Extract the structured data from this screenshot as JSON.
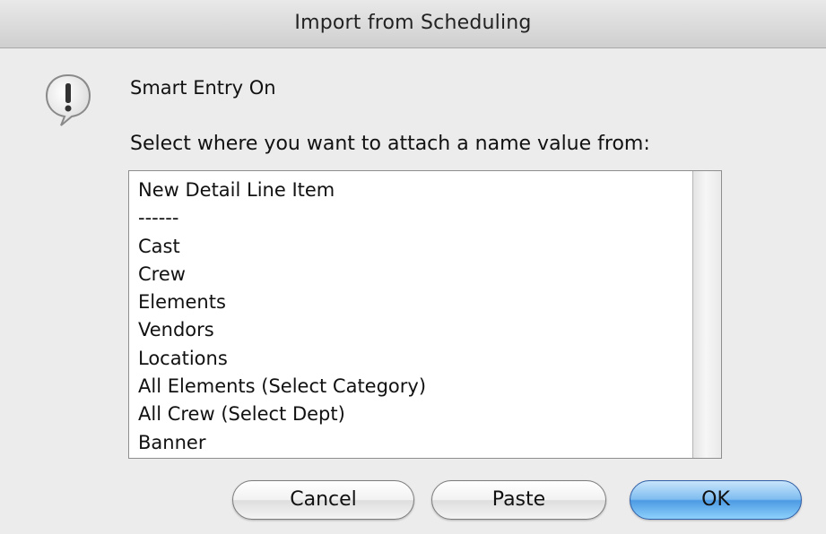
{
  "window": {
    "title": "Import from Scheduling"
  },
  "dialog": {
    "icon": "alert-icon",
    "heading": "Smart Entry On",
    "prompt": "Select where you want to attach a name value from:",
    "list_items": [
      "New Detail Line Item",
      "------",
      "Cast",
      "Crew",
      "Elements",
      "Vendors",
      "Locations",
      "All Elements (Select Category)",
      "All Crew (Select Dept)",
      "Banner"
    ]
  },
  "buttons": {
    "cancel_label": "Cancel",
    "paste_label": "Paste",
    "ok_label": "OK"
  },
  "colors": {
    "default_button": "#5aa7ea",
    "background": "#ececec"
  }
}
